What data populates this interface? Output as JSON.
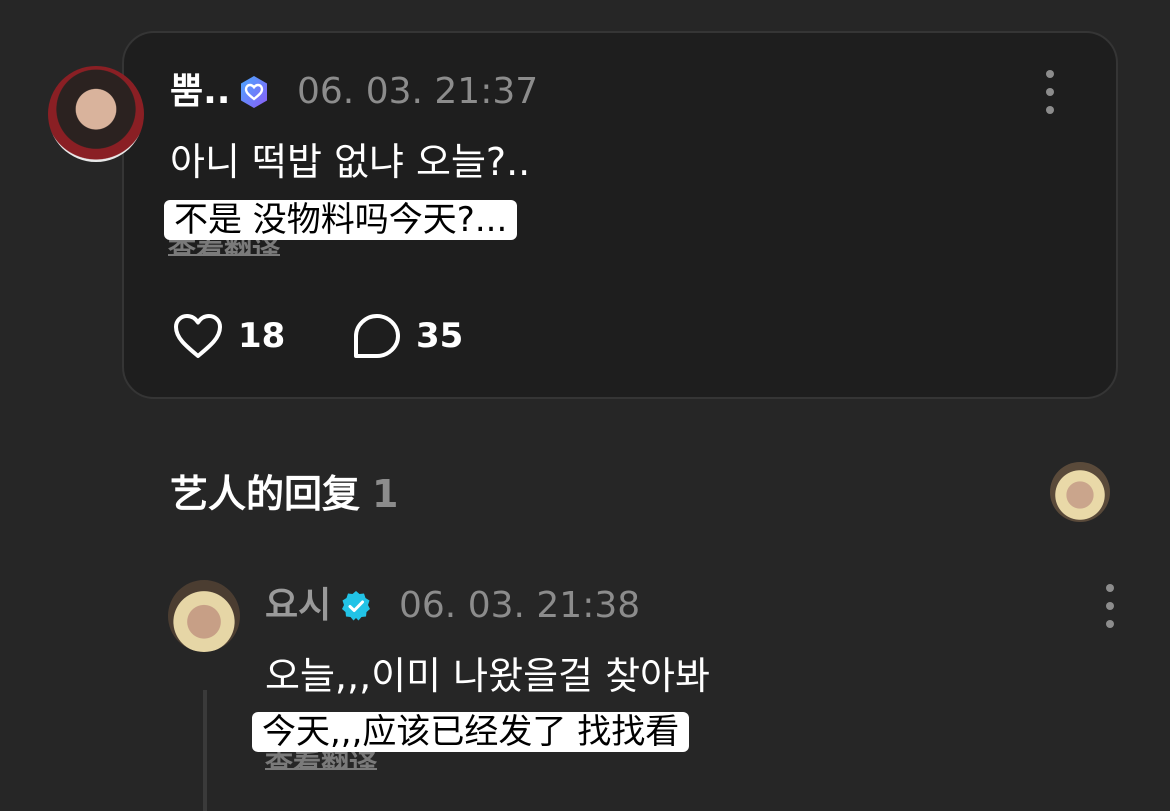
{
  "post": {
    "username": "뿜..",
    "timestamp": "06. 03. 21:37",
    "text": "아니 떡밥 없냐 오늘?..",
    "translation": "不是 没物料吗今天?...",
    "see_translation_label": "查看翻译",
    "likes": "18",
    "comments": "35",
    "badge_icon": "fan-heart-badge-icon",
    "badge_color": "#7b61ff"
  },
  "section": {
    "title": "艺人的回复",
    "count": "1"
  },
  "reply": {
    "username": "요시",
    "timestamp": "06. 03. 21:38",
    "text": "오늘,,,이미 나왔을걸 찾아봐",
    "translation": "今天,,,应该已经发了 找找看",
    "see_translation_label": "查看翻译",
    "badge_icon": "verified-badge-icon",
    "badge_color": "#22c3e6"
  }
}
